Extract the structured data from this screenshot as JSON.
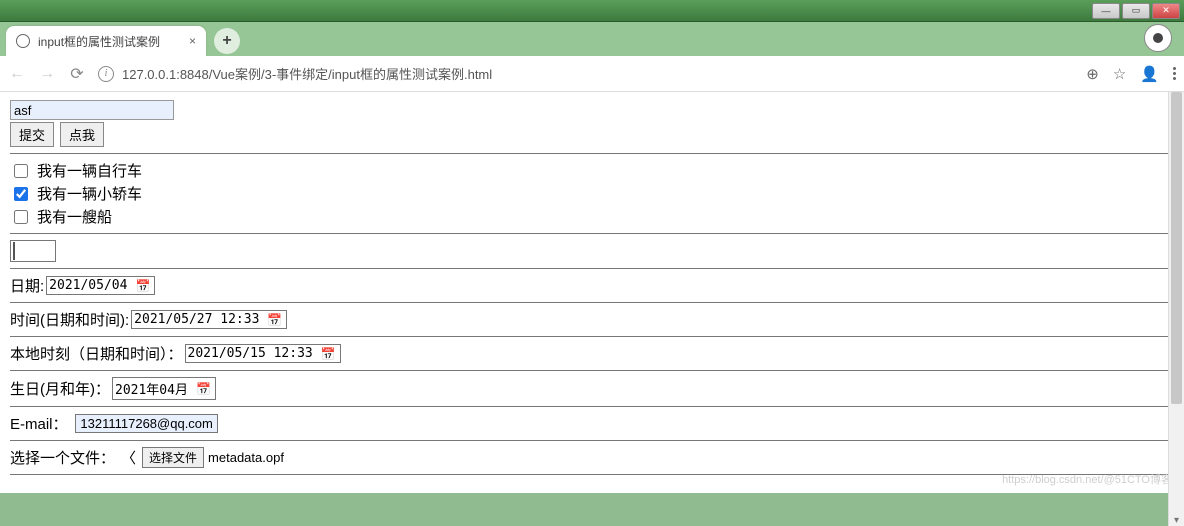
{
  "window": {
    "tab_title": "input框的属性测试案例",
    "url": "127.0.0.1:8848/Vue案例/3-事件绑定/input框的属性测试案例.html"
  },
  "form": {
    "text_value": "asf",
    "submit_label": "提交",
    "click_me_label": "点我",
    "checkboxes": [
      {
        "label": "我有一辆自行车",
        "checked": false
      },
      {
        "label": "我有一辆小轿车",
        "checked": true
      },
      {
        "label": "我有一艘船",
        "checked": false
      }
    ],
    "color_value": "#ee82ee",
    "date": {
      "label": "日期:",
      "value": "2021/05/04"
    },
    "datetime": {
      "label": "时间(日期和时间):",
      "value": "2021/05/27 12:33"
    },
    "datetime_local": {
      "label": "本地时刻（日期和时间）：",
      "value": "2021/05/15 12:33"
    },
    "month": {
      "label": "生日(月和年)：",
      "value": "2021年04月"
    },
    "email": {
      "label": "E-mail：",
      "value": "13211117268@qq.com"
    },
    "file": {
      "label": "选择一个文件：",
      "button": "选择文件",
      "filename": "metadata.opf"
    }
  },
  "watermark": "https://blog.csdn.net/@51CTO博客"
}
